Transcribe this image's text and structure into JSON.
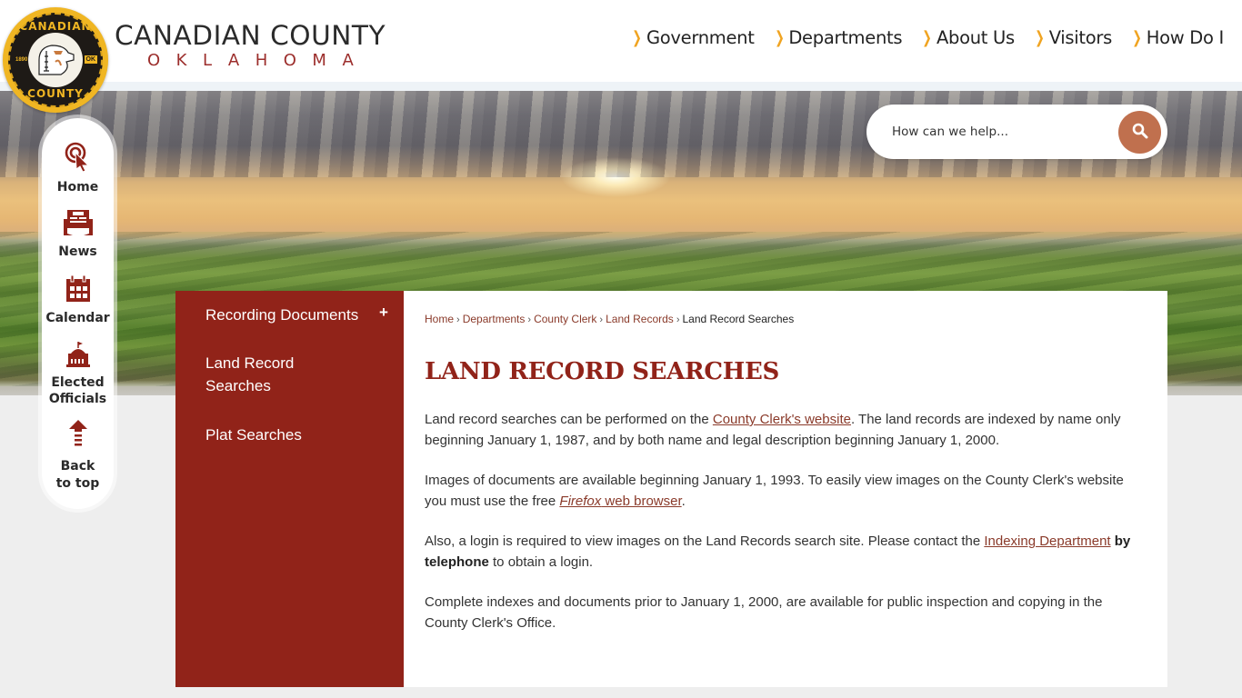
{
  "brand": {
    "title": "CANADIAN COUNTY",
    "subtitle": "OKLAHOMA",
    "seal": {
      "top_text": "CANADIAN",
      "bottom_text": "COUNTY",
      "year": "1890",
      "state": "OK"
    }
  },
  "topnav": {
    "items": [
      {
        "label": "Government"
      },
      {
        "label": "Departments"
      },
      {
        "label": "About Us"
      },
      {
        "label": "Visitors"
      },
      {
        "label": "How Do I"
      }
    ]
  },
  "search": {
    "placeholder": "How can we help...",
    "value": "",
    "button_icon": "search-icon"
  },
  "quicklinks": {
    "items": [
      {
        "label": "Home",
        "icon": "pointer-click-icon"
      },
      {
        "label": "News",
        "icon": "newspaper-icon"
      },
      {
        "label": "Calendar",
        "icon": "calendar-icon"
      },
      {
        "label_line1": "Elected",
        "label_line2": "Officials",
        "icon": "capitol-building-icon"
      },
      {
        "label_line1": "Back",
        "label_line2": "to top",
        "icon": "arrow-up-icon"
      }
    ]
  },
  "subnav": {
    "items": [
      {
        "label": "Recording Documents",
        "expand": "+"
      },
      {
        "label_line1": "Land Record",
        "label_line2": "Searches"
      },
      {
        "label": "Plat Searches"
      }
    ]
  },
  "breadcrumb": {
    "items": [
      "Home",
      "Departments",
      "County Clerk",
      "Land Records"
    ],
    "current": "Land Record Searches",
    "separator": "›"
  },
  "page": {
    "title": "LAND RECORD SEARCHES",
    "p1": {
      "before": "Land record searches can be performed on the ",
      "link": "County Clerk's website",
      "after": ". The land records are indexed by name only beginning January 1, 1987, and by both name and legal description beginning January 1, 2000."
    },
    "p2": {
      "before": "Images of documents are available beginning January 1, 1993. To easily view images on the County Clerk's website you must use the free ",
      "link_italic": "Firefox",
      "link_rest": " web browser",
      "after": "."
    },
    "p3": {
      "before": "Also, a login is required to view images on the Land Records search site. Please contact the ",
      "link": "Indexing Department",
      "bold": " by telephone",
      "after": " to obtain a login."
    },
    "p4": "Complete indexes and documents prior to January 1, 2000, are available for public inspection and copying in the County Clerk's Office."
  },
  "colors": {
    "brand_red": "#912319",
    "accent_orange": "#f0a422",
    "search_button": "#c0704e",
    "link": "#8a3a2a"
  }
}
